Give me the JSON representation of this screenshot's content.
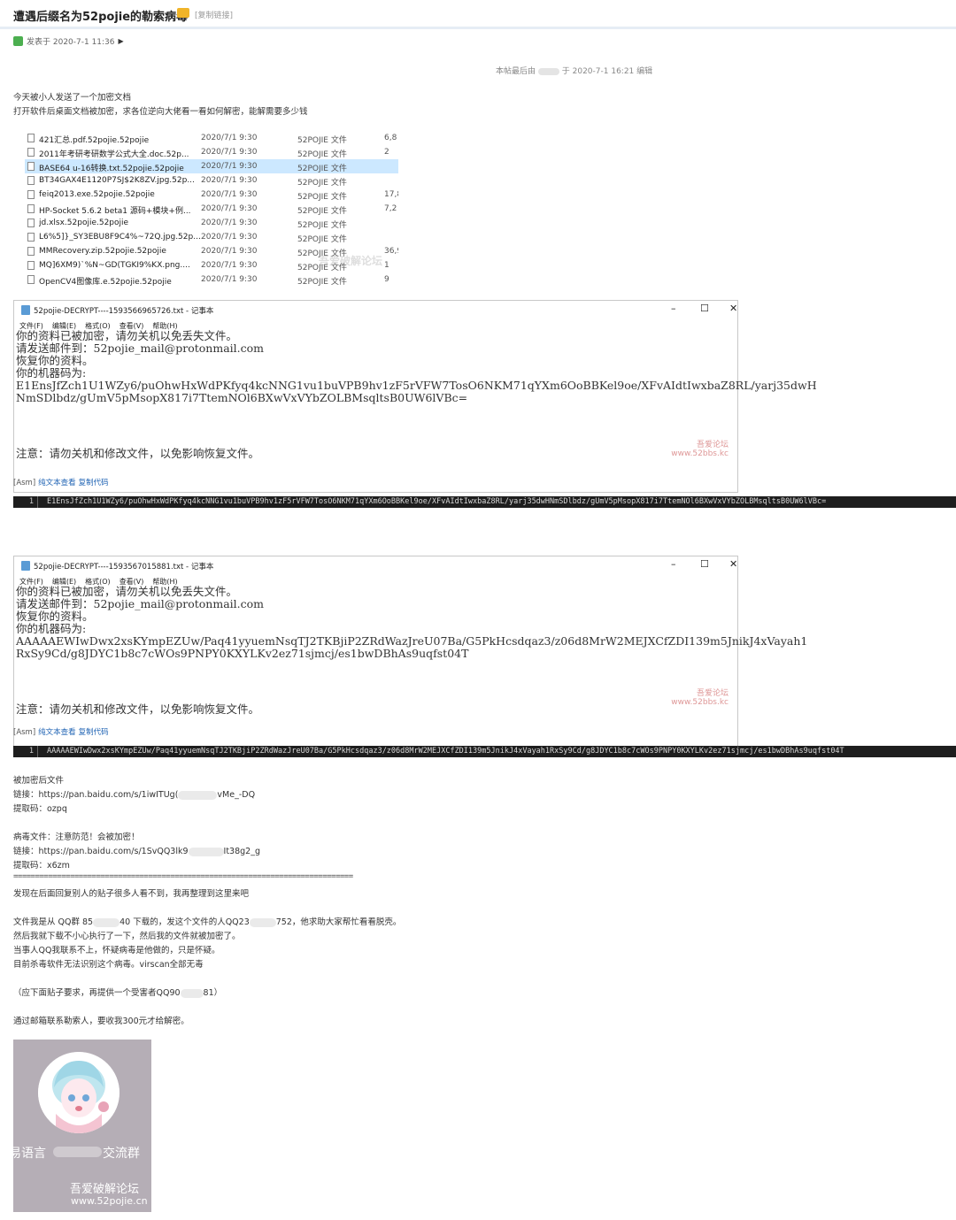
{
  "header": {
    "title": "遭遇后缀名为52pojie的勒索病毒",
    "copy_link": "[复制链接]",
    "posted": "发表于 2020-7-1 11:36",
    "edit_prefix": "本帖最后由",
    "edit_suffix": "于 2020-7-1 16:21 编辑"
  },
  "intro": {
    "line1": "今天被小人发送了一个加密文档",
    "line2": "打开软件后桌面文档被加密，求各位逆向大佬看一看如何解密，能解需要多少钱"
  },
  "file_list": [
    {
      "name": "421汇总.pdf.52pojie.52pojie",
      "date": "2020/7/1 9:30",
      "type": "52POJIE 文件",
      "size": "6,8"
    },
    {
      "name": "2011年考研考研数学公式大全.doc.52p...",
      "date": "2020/7/1 9:30",
      "type": "52POJIE 文件",
      "size": "2"
    },
    {
      "name": "BASE64 u-16转换.txt.52pojie.52pojie",
      "date": "2020/7/1 9:30",
      "type": "52POJIE 文件",
      "size": ""
    },
    {
      "name": "BT34GAX4E1120P7SJ$2K8ZV.jpg.52p...",
      "date": "2020/7/1 9:30",
      "type": "52POJIE 文件",
      "size": ""
    },
    {
      "name": "feiq2013.exe.52pojie.52pojie",
      "date": "2020/7/1 9:30",
      "type": "52POJIE 文件",
      "size": "17,8"
    },
    {
      "name": "HP-Socket 5.6.2 beta1 源码+模块+例...",
      "date": "2020/7/1 9:30",
      "type": "52POJIE 文件",
      "size": "7,2"
    },
    {
      "name": "jd.xlsx.52pojie.52pojie",
      "date": "2020/7/1 9:30",
      "type": "52POJIE 文件",
      "size": ""
    },
    {
      "name": "L6%5]}_SY3EBU8F9C4%~72Q.jpg.52p...",
      "date": "2020/7/1 9:30",
      "type": "52POJIE 文件",
      "size": ""
    },
    {
      "name": "MMRecovery.zip.52pojie.52pojie",
      "date": "2020/7/1 9:30",
      "type": "52POJIE 文件",
      "size": "36,9"
    },
    {
      "name": "MQ]6XM9)`%N~GD(TGKI9%KX.png....",
      "date": "2020/7/1 9:30",
      "type": "52POJIE 文件",
      "size": "1"
    },
    {
      "name": "OpenCV4图像库.e.52pojie.52pojie",
      "date": "2020/7/1 9:30",
      "type": "52POJIE 文件",
      "size": "9"
    }
  ],
  "file_watermark": "吾爱破解论坛",
  "notepad1": {
    "title": "52pojie-DECRYPT----1593566965726.txt - 记事本",
    "menu": [
      "文件(F)",
      "编辑(E)",
      "格式(O)",
      "查看(V)",
      "帮助(H)"
    ],
    "lines": [
      "你的资料已被加密，请勿关机以免丢失文件。",
      "请发送邮件到：52pojie_mail@protonmail.com",
      "恢复你的资料。",
      "你的机器码为:",
      "E1EnsJfZch1U1WZy6/puOhwHxWdPKfyq4kcNNG1vu1buVPB9hv1zF5rVFW7TosO6NKM71qYXm6OoBBKel9oe/XFvAIdtIwxbaZ8RL/yarj35dwH",
      "NmSDlbdz/gUmV5pMsopX817i7TtemNOl6BXwVxVYbZOLBMsqltsB0UW6lVBc="
    ],
    "note": "注意：请勿关机和修改文件，以免影响恢复文件。",
    "wm1": "吾爱论坛",
    "wm2": "www.52bbs.kc"
  },
  "code1": {
    "lang": "[Asm]",
    "link1": "纯文本查看",
    "link2": "复制代码",
    "line_no": "1",
    "code": "E1EnsJfZch1U1WZy6/puOhwHxWdPKfyq4kcNNG1vu1buVPB9hv1zF5rVFW7TosO6NKM71qYXm6OoBBKel9oe/XFvAIdtIwxbaZ8RL/yarj35dwHNmSDlbdz/gUmV5pMsopX817i7TtemNOl6BXwVxVYbZOLBMsqltsB0UW6lVBc="
  },
  "notepad2": {
    "title": "52pojie-DECRYPT----1593567015881.txt - 记事本",
    "menu": [
      "文件(F)",
      "编辑(E)",
      "格式(O)",
      "查看(V)",
      "帮助(H)"
    ],
    "lines": [
      "你的资料已被加密，请勿关机以免丢失文件。",
      "请发送邮件到：52pojie_mail@protonmail.com",
      "恢复你的资料。",
      "你的机器码为:",
      "AAAAAEWIwDwx2xsKYmpEZUw/Paq41yyuemNsqTJ2TKBjiP2ZRdWazJreU07Ba/G5PkHcsdqaz3/z06d8MrW2MEJXCfZDI139m5JnikJ4xVayah1",
      "RxSy9Cd/g8JDYC1b8c7cWOs9PNPY0KXYLKv2ez71sjmcj/es1bwDBhAs9uqfst04T"
    ],
    "note": "注意：请勿关机和修改文件，以免影响恢复文件。",
    "wm1": "吾爱论坛",
    "wm2": "www.52bbs.kc"
  },
  "code2": {
    "lang": "[Asm]",
    "link1": "纯文本查看",
    "link2": "复制代码",
    "line_no": "1",
    "code": "AAAAAEWIwDwx2xsKYmpEZUw/Paq41yyuemNsqTJ2TKBjiP2ZRdWazJreU07Ba/G5PkHcsdqaz3/z06d8MrW2MEJXCfZDI139m5JnikJ4xVayah1RxSy9Cd/g8JDYC1b8c7cWOs9PNPY0KXYLKv2ez71sjmcj/es1bwDBhAs9uqfst04T"
  },
  "links": {
    "enc_label": "被加密后文件",
    "enc_link_prefix": "链接：https://pan.baidu.com/s/1iwITUg(",
    "enc_link_suffix": "vMe_-DQ",
    "enc_code": "提取码：ozpq",
    "virus_label": "病毒文件：注意防范！会被加密！",
    "virus_link_prefix": "链接：https://pan.baidu.com/s/1SvQQ3lk9",
    "virus_link_suffix": "It38g2_g",
    "virus_code": "提取码：x6zm"
  },
  "separator": "==============================================================================",
  "body_text": {
    "repost": "发现在后面回复别人的贴子很多人看不到，我再整理到这里来吧",
    "p1_a": "文件我是从 QQ群 85",
    "p1_b": "40 下载的，发这个文件的人QQ23",
    "p1_c": "752，他求助大家帮忙看看脱壳。",
    "p2": "然后我就下载不小心执行了一下，然后我的文件就被加密了。",
    "p3": "当事人QQ我联系不上，怀疑病毒是他做的，只是怀疑。",
    "p4": "目前杀毒软件无法识别这个病毒。virscan全部无毒",
    "p5_a": "（应下面贴子要求，再提供一个受害者QQ90",
    "p5_b": "81）",
    "p6": "通过邮箱联系勒索人，要收我300元才给解密。"
  },
  "qr": {
    "group_left": "易语言",
    "group_right": "交流群",
    "wm1": "吾爱破解论坛",
    "wm2": "www.52pojie.cn"
  }
}
